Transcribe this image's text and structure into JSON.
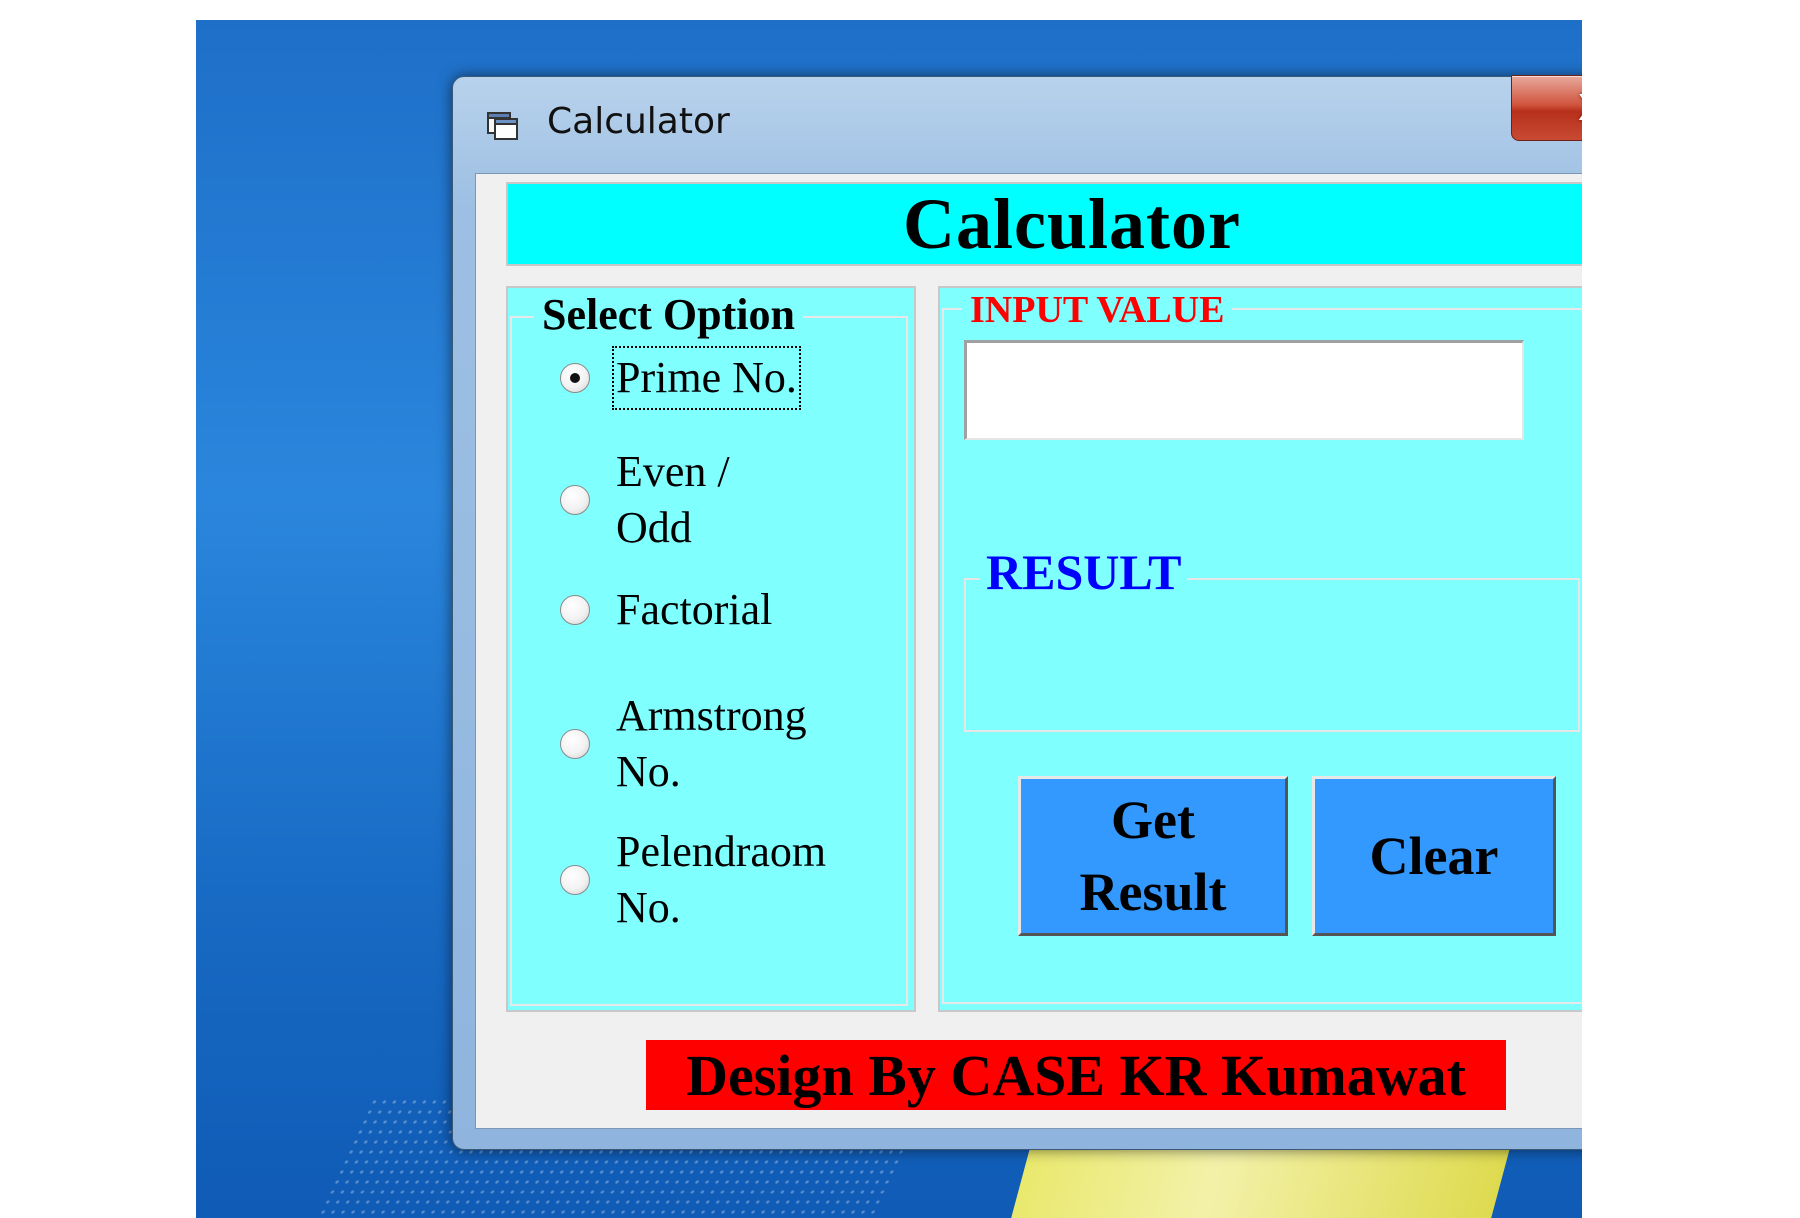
{
  "window": {
    "title": "Calculator",
    "close_label": "X"
  },
  "header": {
    "title": "Calculator"
  },
  "options": {
    "legend": "Select Option",
    "items": [
      {
        "line1": "Prime No.",
        "line2": "",
        "checked": true
      },
      {
        "line1": "Even /",
        "line2": "Odd",
        "checked": false
      },
      {
        "line1": "Factorial",
        "line2": "",
        "checked": false
      },
      {
        "line1": "Armstrong",
        "line2": "No.",
        "checked": false
      },
      {
        "line1": "Pelendraom",
        "line2": "No.",
        "checked": false
      }
    ]
  },
  "input": {
    "legend": "INPUT VALUE",
    "value": ""
  },
  "result": {
    "legend": "RESULT",
    "value": ""
  },
  "buttons": {
    "get_line1": "Get",
    "get_line2": "Result",
    "clear": "Clear"
  },
  "footer": {
    "credit": "Design By CASE KR Kumawat"
  },
  "colors": {
    "header_bg": "#00ffff",
    "panel_bg": "#80ffff",
    "input_legend": "#ff0000",
    "result_legend": "#0000ff",
    "button_bg": "#3399ff",
    "footer_bg": "#ff0000"
  },
  "icons": {
    "app": "window-app-icon",
    "close": "close-icon"
  }
}
